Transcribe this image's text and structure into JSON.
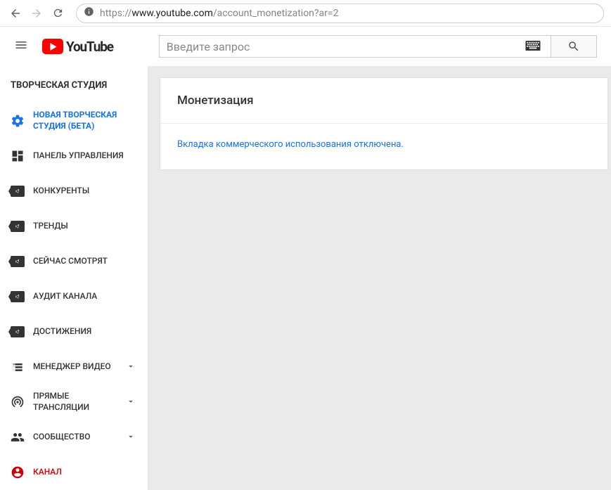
{
  "browser": {
    "url_prefix": "https://",
    "url_host": "www.youtube.com",
    "url_path": "/account_monetization?ar=2"
  },
  "header": {
    "logo_text": "YouTube",
    "search_placeholder": "Введите запрос"
  },
  "sidebar": {
    "title": "ТВОРЧЕСКАЯ СТУДИЯ",
    "items": [
      {
        "label": "НОВАЯ ТВОРЧЕСКАЯ СТУДИЯ (БЕТА)",
        "icon": "gear",
        "active": true
      },
      {
        "label": "ПАНЕЛЬ УПРАВЛЕНИЯ",
        "icon": "dashboard"
      },
      {
        "label": "КОНКУРЕНТЫ",
        "icon": "playtag"
      },
      {
        "label": "ТРЕНДЫ",
        "icon": "playtag"
      },
      {
        "label": "СЕЙЧАС СМОТРЯТ",
        "icon": "playtag"
      },
      {
        "label": "АУДИТ КАНАЛА",
        "icon": "playtag"
      },
      {
        "label": "ДОСТИЖЕНИЯ",
        "icon": "playtag"
      },
      {
        "label": "МЕНЕДЖЕР ВИДЕО",
        "icon": "videomanager",
        "expandable": true
      },
      {
        "label": "ПРЯМЫЕ ТРАНСЛЯЦИИ",
        "icon": "broadcast",
        "expandable": true
      },
      {
        "label": "СООБЩЕСТВО",
        "icon": "community",
        "expandable": true
      },
      {
        "label": "КАНАЛ",
        "icon": "channel",
        "red": true,
        "expandable": false
      }
    ]
  },
  "content": {
    "title": "Монетизация",
    "message": "Вкладка коммерческого использования отключена."
  }
}
